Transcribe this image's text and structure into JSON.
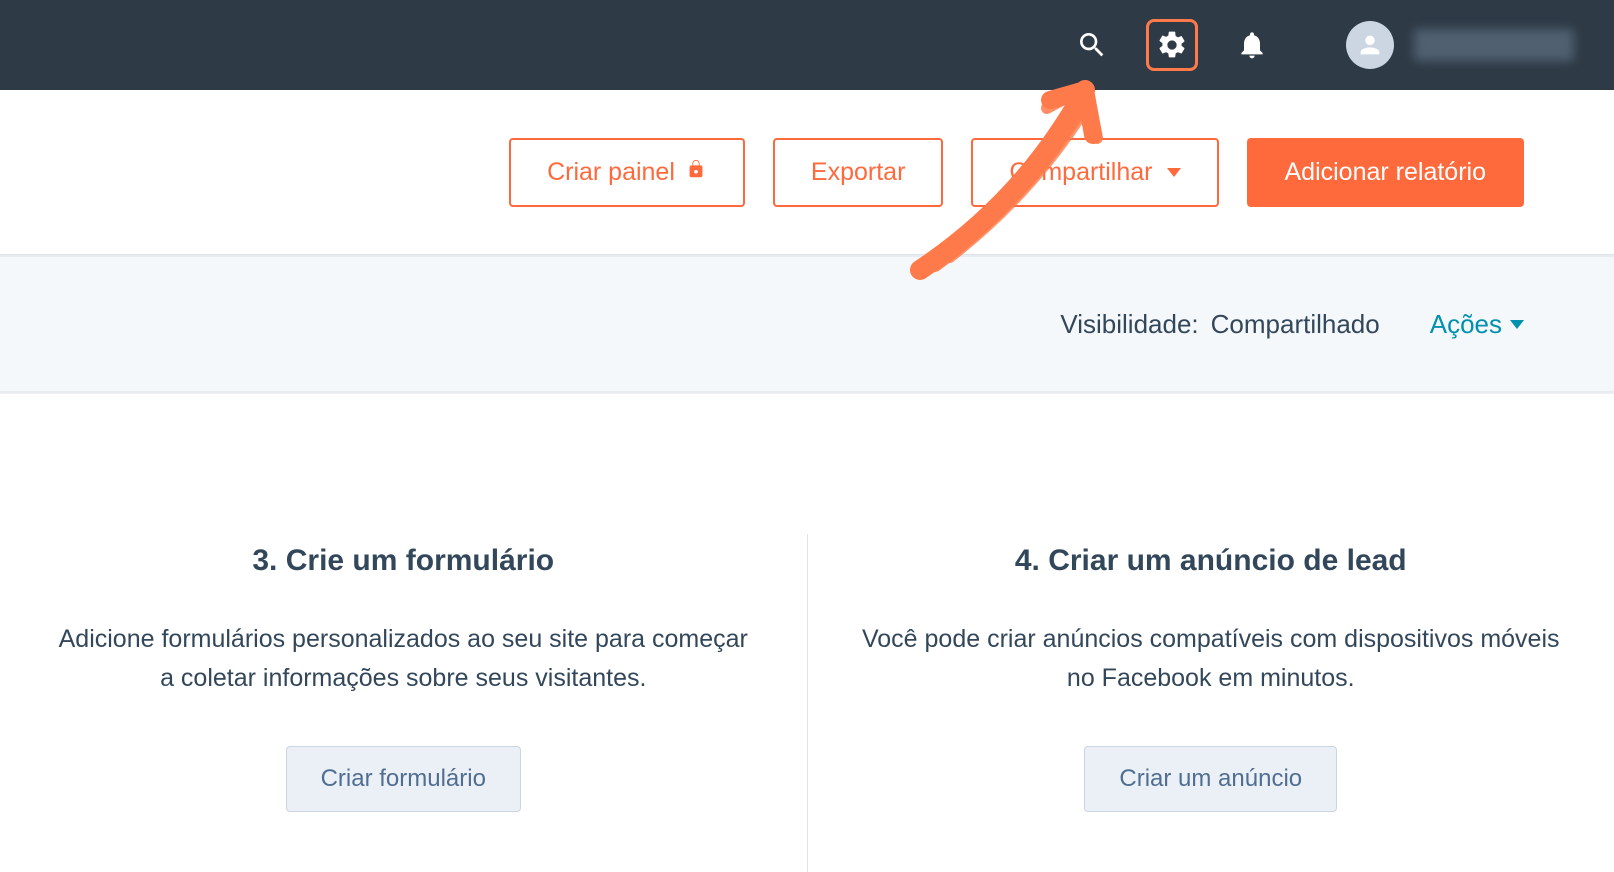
{
  "toolbar": {
    "create_panel": "Criar painel",
    "export": "Exportar",
    "share": "Compartilhar",
    "add_report": "Adicionar relatório"
  },
  "visibility": {
    "label": "Visibilidade:",
    "value": "Compartilhado",
    "actions": "Ações"
  },
  "cards": [
    {
      "title": "3. Crie um formulário",
      "desc": "Adicione formulários personalizados ao seu site para começar a coletar informações sobre seus visitantes.",
      "button": "Criar formulário"
    },
    {
      "title": "4. Criar um anúncio de lead",
      "desc": "Você pode criar anúncios compatíveis com dispositivos móveis no Facebook em minutos.",
      "button": "Criar um anúncio"
    }
  ]
}
